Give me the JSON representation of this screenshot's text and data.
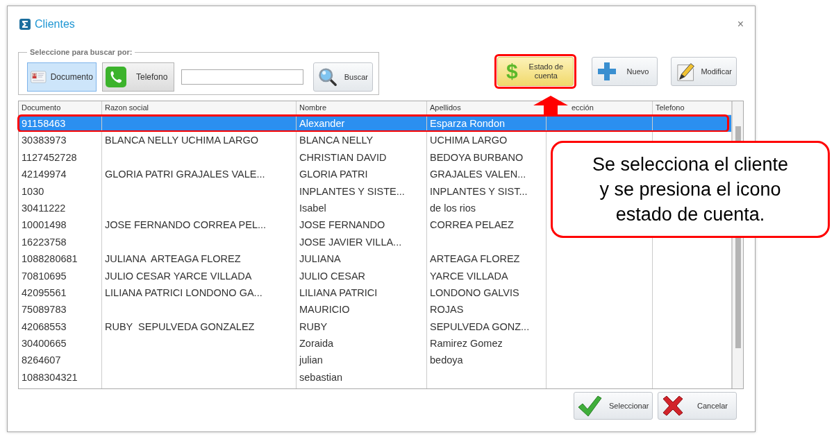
{
  "window": {
    "title": "Clientes",
    "close": "×"
  },
  "search": {
    "legend": "Seleccione para buscar por:",
    "options": [
      {
        "label": "Documento",
        "kind": "document",
        "selected": true
      },
      {
        "label": "Telefono",
        "kind": "phone",
        "selected": false
      }
    ],
    "button": "Buscar"
  },
  "actions": [
    {
      "label": "Estado de cuenta",
      "kind": "dollar",
      "icon_text": "$",
      "highlighted": true
    },
    {
      "label": "Nuevo",
      "kind": "plus",
      "highlighted": false
    },
    {
      "label": "Modificar",
      "kind": "pencil",
      "highlighted": false
    }
  ],
  "table": {
    "columns": [
      "Documento",
      "Razon social",
      "Nombre",
      "Apellidos",
      "ección",
      "Telefono"
    ],
    "rows": [
      {
        "selected": true,
        "cells": [
          "91158463",
          null,
          "Alexander",
          "Esparza Rondon",
          null,
          null
        ]
      },
      {
        "selected": false,
        "cells": [
          "30383973",
          "BLANCA NELLY UCHIMA LARGO",
          "BLANCA NELLY",
          "UCHIMA LARGO",
          null,
          null
        ]
      },
      {
        "selected": false,
        "cells": [
          "1127452728",
          null,
          "CHRISTIAN DAVID",
          "BEDOYA BURBANO",
          null,
          null
        ]
      },
      {
        "selected": false,
        "cells": [
          "42149974",
          "GLORIA PATRI GRAJALES VALE...",
          "GLORIA PATRI",
          "GRAJALES VALEN...",
          null,
          null
        ]
      },
      {
        "selected": false,
        "cells": [
          "1030",
          null,
          "INPLANTES Y SISTE...",
          "INPLANTES Y SIST...",
          null,
          null
        ]
      },
      {
        "selected": false,
        "cells": [
          "30411222",
          null,
          "Isabel",
          "de los rios",
          null,
          null
        ]
      },
      {
        "selected": false,
        "cells": [
          "10001498",
          "JOSE FERNANDO CORREA PEL...",
          "JOSE FERNANDO",
          "CORREA PELAEZ",
          null,
          null
        ]
      },
      {
        "selected": false,
        "cells": [
          "16223758",
          null,
          "JOSE JAVIER VILLA...",
          null,
          null,
          null
        ]
      },
      {
        "selected": false,
        "cells": [
          "1088280681",
          "JULIANA  ARTEAGA FLOREZ",
          "JULIANA",
          "ARTEAGA FLOREZ",
          null,
          null
        ]
      },
      {
        "selected": false,
        "cells": [
          "70810695",
          "JULIO CESAR YARCE VILLADA",
          "JULIO CESAR",
          "YARCE VILLADA",
          null,
          null
        ]
      },
      {
        "selected": false,
        "cells": [
          "42095561",
          "LILIANA PATRICI LONDONO GA...",
          "LILIANA PATRICI",
          "LONDONO GALVIS",
          null,
          null
        ]
      },
      {
        "selected": false,
        "cells": [
          "75089783",
          null,
          "MAURICIO",
          "ROJAS",
          null,
          null
        ]
      },
      {
        "selected": false,
        "cells": [
          "42068553",
          "RUBY  SEPULVEDA GONZALEZ",
          "RUBY",
          "SEPULVEDA GONZ...",
          null,
          null
        ]
      },
      {
        "selected": false,
        "cells": [
          "30400665",
          null,
          "Zoraida",
          "Ramirez Gomez",
          null,
          null
        ]
      },
      {
        "selected": false,
        "cells": [
          "8264607",
          null,
          "julian",
          "bedoya",
          null,
          null
        ]
      },
      {
        "selected": false,
        "cells": [
          "1088304321",
          null,
          "sebastian",
          null,
          null,
          null
        ]
      }
    ]
  },
  "footer_buttons": [
    {
      "label": "Seleccionar",
      "kind": "check"
    },
    {
      "label": "Cancelar",
      "kind": "cross"
    }
  ],
  "callout": "Se selecciona el cliente\ny se presiona el icono\nestado de cuenta."
}
